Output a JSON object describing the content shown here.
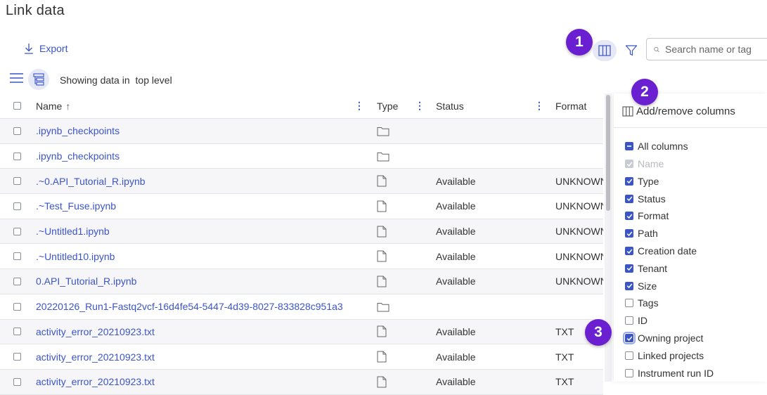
{
  "page": {
    "title": "Link data"
  },
  "toolbar": {
    "export_label": "Export",
    "search_placeholder": "Search name or tag"
  },
  "view": {
    "showing_prefix": "Showing data in",
    "level": "top level"
  },
  "markers": [
    "1",
    "2",
    "3"
  ],
  "table": {
    "columns": {
      "name": "Name",
      "name_sort": "↑",
      "type": "Type",
      "status": "Status",
      "format": "Format"
    },
    "rows": [
      {
        "name": ".ipynb_checkpoints",
        "type": "folder",
        "status": "",
        "format": ""
      },
      {
        "name": ".ipynb_checkpoints",
        "type": "folder",
        "status": "",
        "format": ""
      },
      {
        "name": ".~0.API_Tutorial_R.ipynb",
        "type": "file",
        "status": "Available",
        "format": "UNKNOWN"
      },
      {
        "name": ".~Test_Fuse.ipynb",
        "type": "file",
        "status": "Available",
        "format": "UNKNOWN"
      },
      {
        "name": ".~Untitled1.ipynb",
        "type": "file",
        "status": "Available",
        "format": "UNKNOWN"
      },
      {
        "name": ".~Untitled10.ipynb",
        "type": "file",
        "status": "Available",
        "format": "UNKNOWN"
      },
      {
        "name": "0.API_Tutorial_R.ipynb",
        "type": "file",
        "status": "Available",
        "format": "UNKNOWN"
      },
      {
        "name": "20220126_Run1-Fastq2vcf-16d4fe54-5447-4d39-8027-833828c951a3",
        "type": "folder",
        "status": "",
        "format": ""
      },
      {
        "name": "activity_error_20210923.txt",
        "type": "file",
        "status": "Available",
        "format": "TXT"
      },
      {
        "name": "activity_error_20210923.txt",
        "type": "file",
        "status": "Available",
        "format": "TXT"
      },
      {
        "name": "activity_error_20210923.txt",
        "type": "file",
        "status": "Available",
        "format": "TXT"
      }
    ]
  },
  "columns_panel": {
    "title": "Add/remove columns",
    "all_label": "All columns",
    "options": [
      {
        "label": "Name",
        "state": "disabled"
      },
      {
        "label": "Type",
        "state": "checked"
      },
      {
        "label": "Status",
        "state": "checked"
      },
      {
        "label": "Format",
        "state": "checked"
      },
      {
        "label": "Path",
        "state": "checked"
      },
      {
        "label": "Creation date",
        "state": "checked"
      },
      {
        "label": "Tenant",
        "state": "checked"
      },
      {
        "label": "Size",
        "state": "checked"
      },
      {
        "label": "Tags",
        "state": "unchecked"
      },
      {
        "label": "ID",
        "state": "unchecked"
      },
      {
        "label": "Owning project",
        "state": "checked"
      },
      {
        "label": "Linked projects",
        "state": "unchecked"
      },
      {
        "label": "Instrument run ID",
        "state": "unchecked"
      }
    ]
  },
  "colors": {
    "accent": "#3b55c9",
    "marker": "#6a1fd0"
  }
}
